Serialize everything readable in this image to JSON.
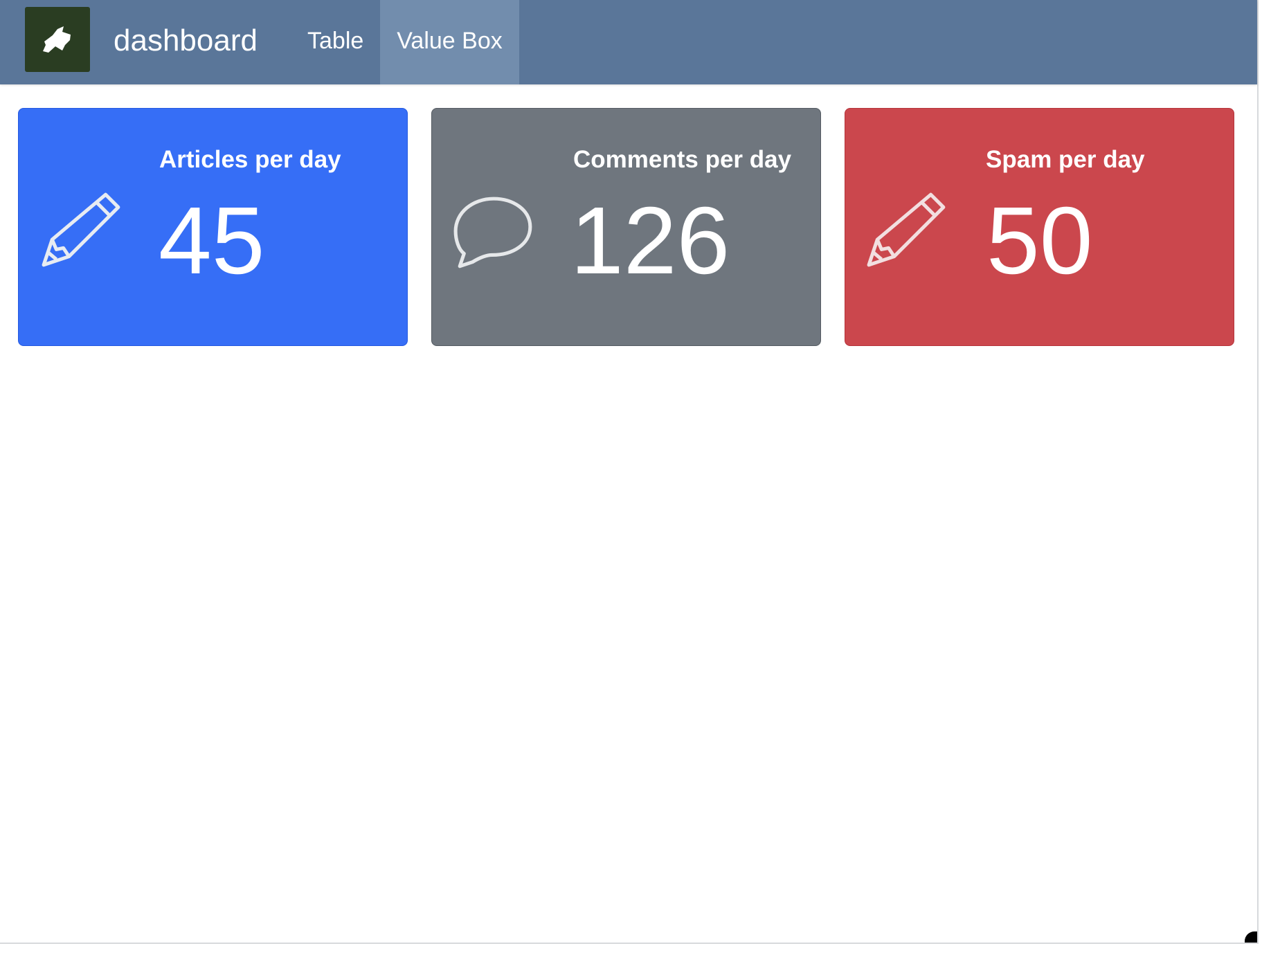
{
  "app": {
    "title": "dashboard",
    "logo_icon": "leaf-icon"
  },
  "nav": {
    "tabs": [
      {
        "label": "Table",
        "active": false
      },
      {
        "label": "Value Box",
        "active": true
      }
    ]
  },
  "value_boxes": [
    {
      "title": "Articles per day",
      "value": "45",
      "icon": "pencil-icon",
      "color": "#366ef6"
    },
    {
      "title": "Comments per day",
      "value": "126",
      "icon": "speech-bubble-icon",
      "color": "#6f767e"
    },
    {
      "title": "Spam per day",
      "value": "50",
      "icon": "pencil-icon",
      "color": "#cb474d"
    }
  ],
  "colors": {
    "navbar": "#5a7699",
    "active_tab": "#728dad",
    "logo_bg": "#2a3d22"
  }
}
